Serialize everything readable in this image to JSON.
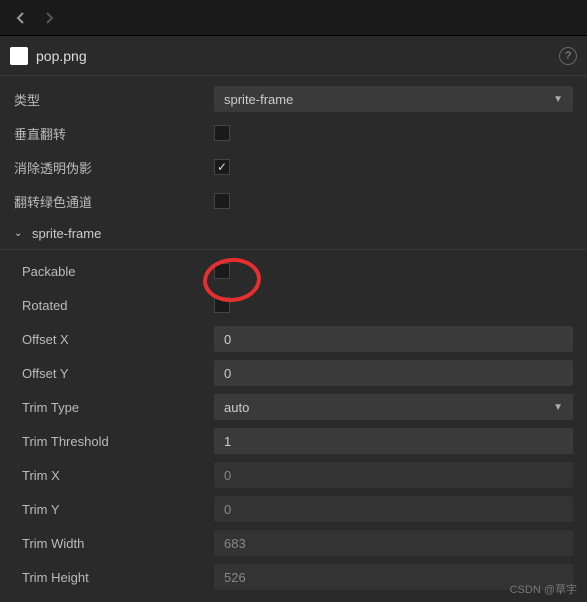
{
  "file": {
    "name": "pop.png"
  },
  "properties": {
    "type": {
      "label": "类型",
      "value": "sprite-frame"
    },
    "flipVertical": {
      "label": "垂直翻转",
      "checked": false
    },
    "removeTransparentGhost": {
      "label": "消除透明伪影",
      "checked": true
    },
    "flipGreenChannel": {
      "label": "翻转绿色通道",
      "checked": false
    }
  },
  "section": {
    "title": "sprite-frame"
  },
  "spriteFrame": {
    "packable": {
      "label": "Packable",
      "checked": false
    },
    "rotated": {
      "label": "Rotated",
      "checked": false
    },
    "offsetX": {
      "label": "Offset X",
      "value": "0"
    },
    "offsetY": {
      "label": "Offset Y",
      "value": "0"
    },
    "trimType": {
      "label": "Trim Type",
      "value": "auto"
    },
    "trimThreshold": {
      "label": "Trim Threshold",
      "value": "1"
    },
    "trimX": {
      "label": "Trim X",
      "value": "0"
    },
    "trimY": {
      "label": "Trim Y",
      "value": "0"
    },
    "trimWidth": {
      "label": "Trim Width",
      "value": "683"
    },
    "trimHeight": {
      "label": "Trim Height",
      "value": "526"
    }
  },
  "watermark": "CSDN @草字"
}
